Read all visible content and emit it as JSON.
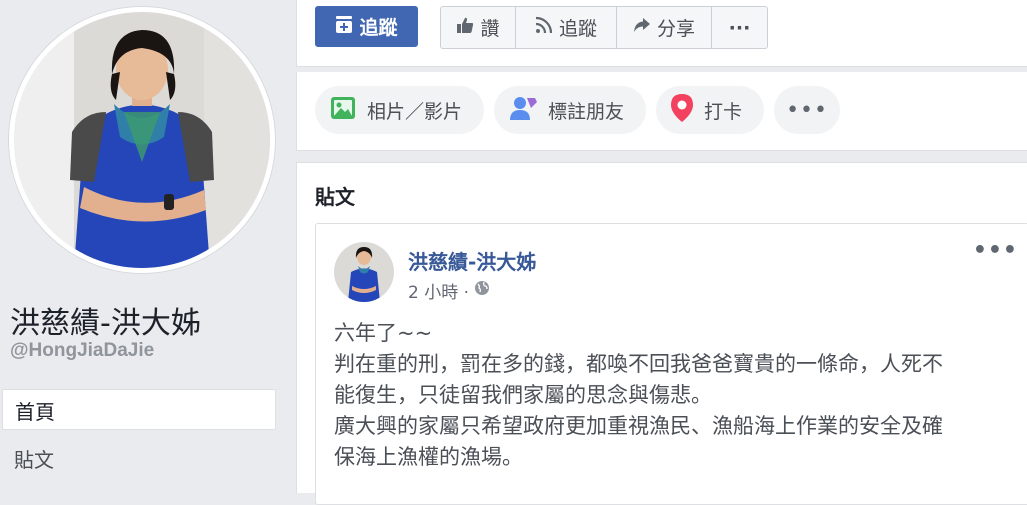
{
  "page": {
    "name": "洪慈績-洪大姊",
    "handle": "@HongJiaDaJie"
  },
  "left_nav": {
    "items": [
      {
        "label": "首頁"
      },
      {
        "label": "貼文"
      }
    ]
  },
  "topbar": {
    "follow_primary": "追蹤",
    "like": "讚",
    "follow": "追蹤",
    "share": "分享",
    "more": "···"
  },
  "composer": {
    "photo_video": "相片／影片",
    "tag_friends": "標註朋友",
    "check_in": "打卡",
    "more": "•••"
  },
  "posts": {
    "heading": "貼文",
    "post": {
      "author": "洪慈績-洪大姊",
      "time": "2 小時 ·",
      "menu": "•••",
      "lines": [
        "六年了~~",
        "判在重的刑，罰在多的錢，都喚不回我爸爸寶貴的一條命，人死不",
        "能復生，只徒留我們家屬的思念與傷悲。",
        "廣大興的家屬只希望政府更加重視漁民、漁船海上作業的安全及確",
        "保海上漁權的漁場。"
      ]
    }
  },
  "colors": {
    "brand_blue": "#4267b2",
    "link_blue": "#385898",
    "background": "#e9ebee"
  }
}
